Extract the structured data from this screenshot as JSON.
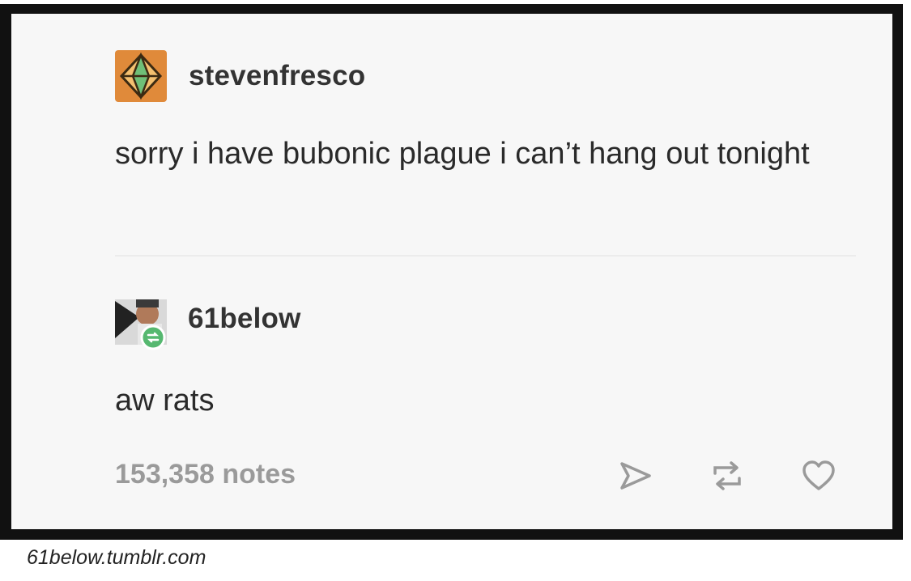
{
  "op_post": {
    "username": "stevenfresco",
    "avatar_icon": "orange-octahedron-avatar",
    "text": "sorry i have bubonic plague i can’t hang out tonight"
  },
  "reblog": {
    "username": "61below",
    "avatar_icon": "61below-avatar-with-reblog-badge",
    "text": "aw rats"
  },
  "footer": {
    "notes": "153,358 notes",
    "share_icon": "share-icon",
    "reblog_icon": "reblog-icon",
    "like_icon": "heart-icon"
  },
  "caption": "61below.tumblr.com",
  "colors": {
    "frame": "#111111",
    "card": "#f7f7f7",
    "avatar_orange": "#e08a3a",
    "reblog_badge": "#56b870",
    "muted": "#9a9a9a"
  }
}
